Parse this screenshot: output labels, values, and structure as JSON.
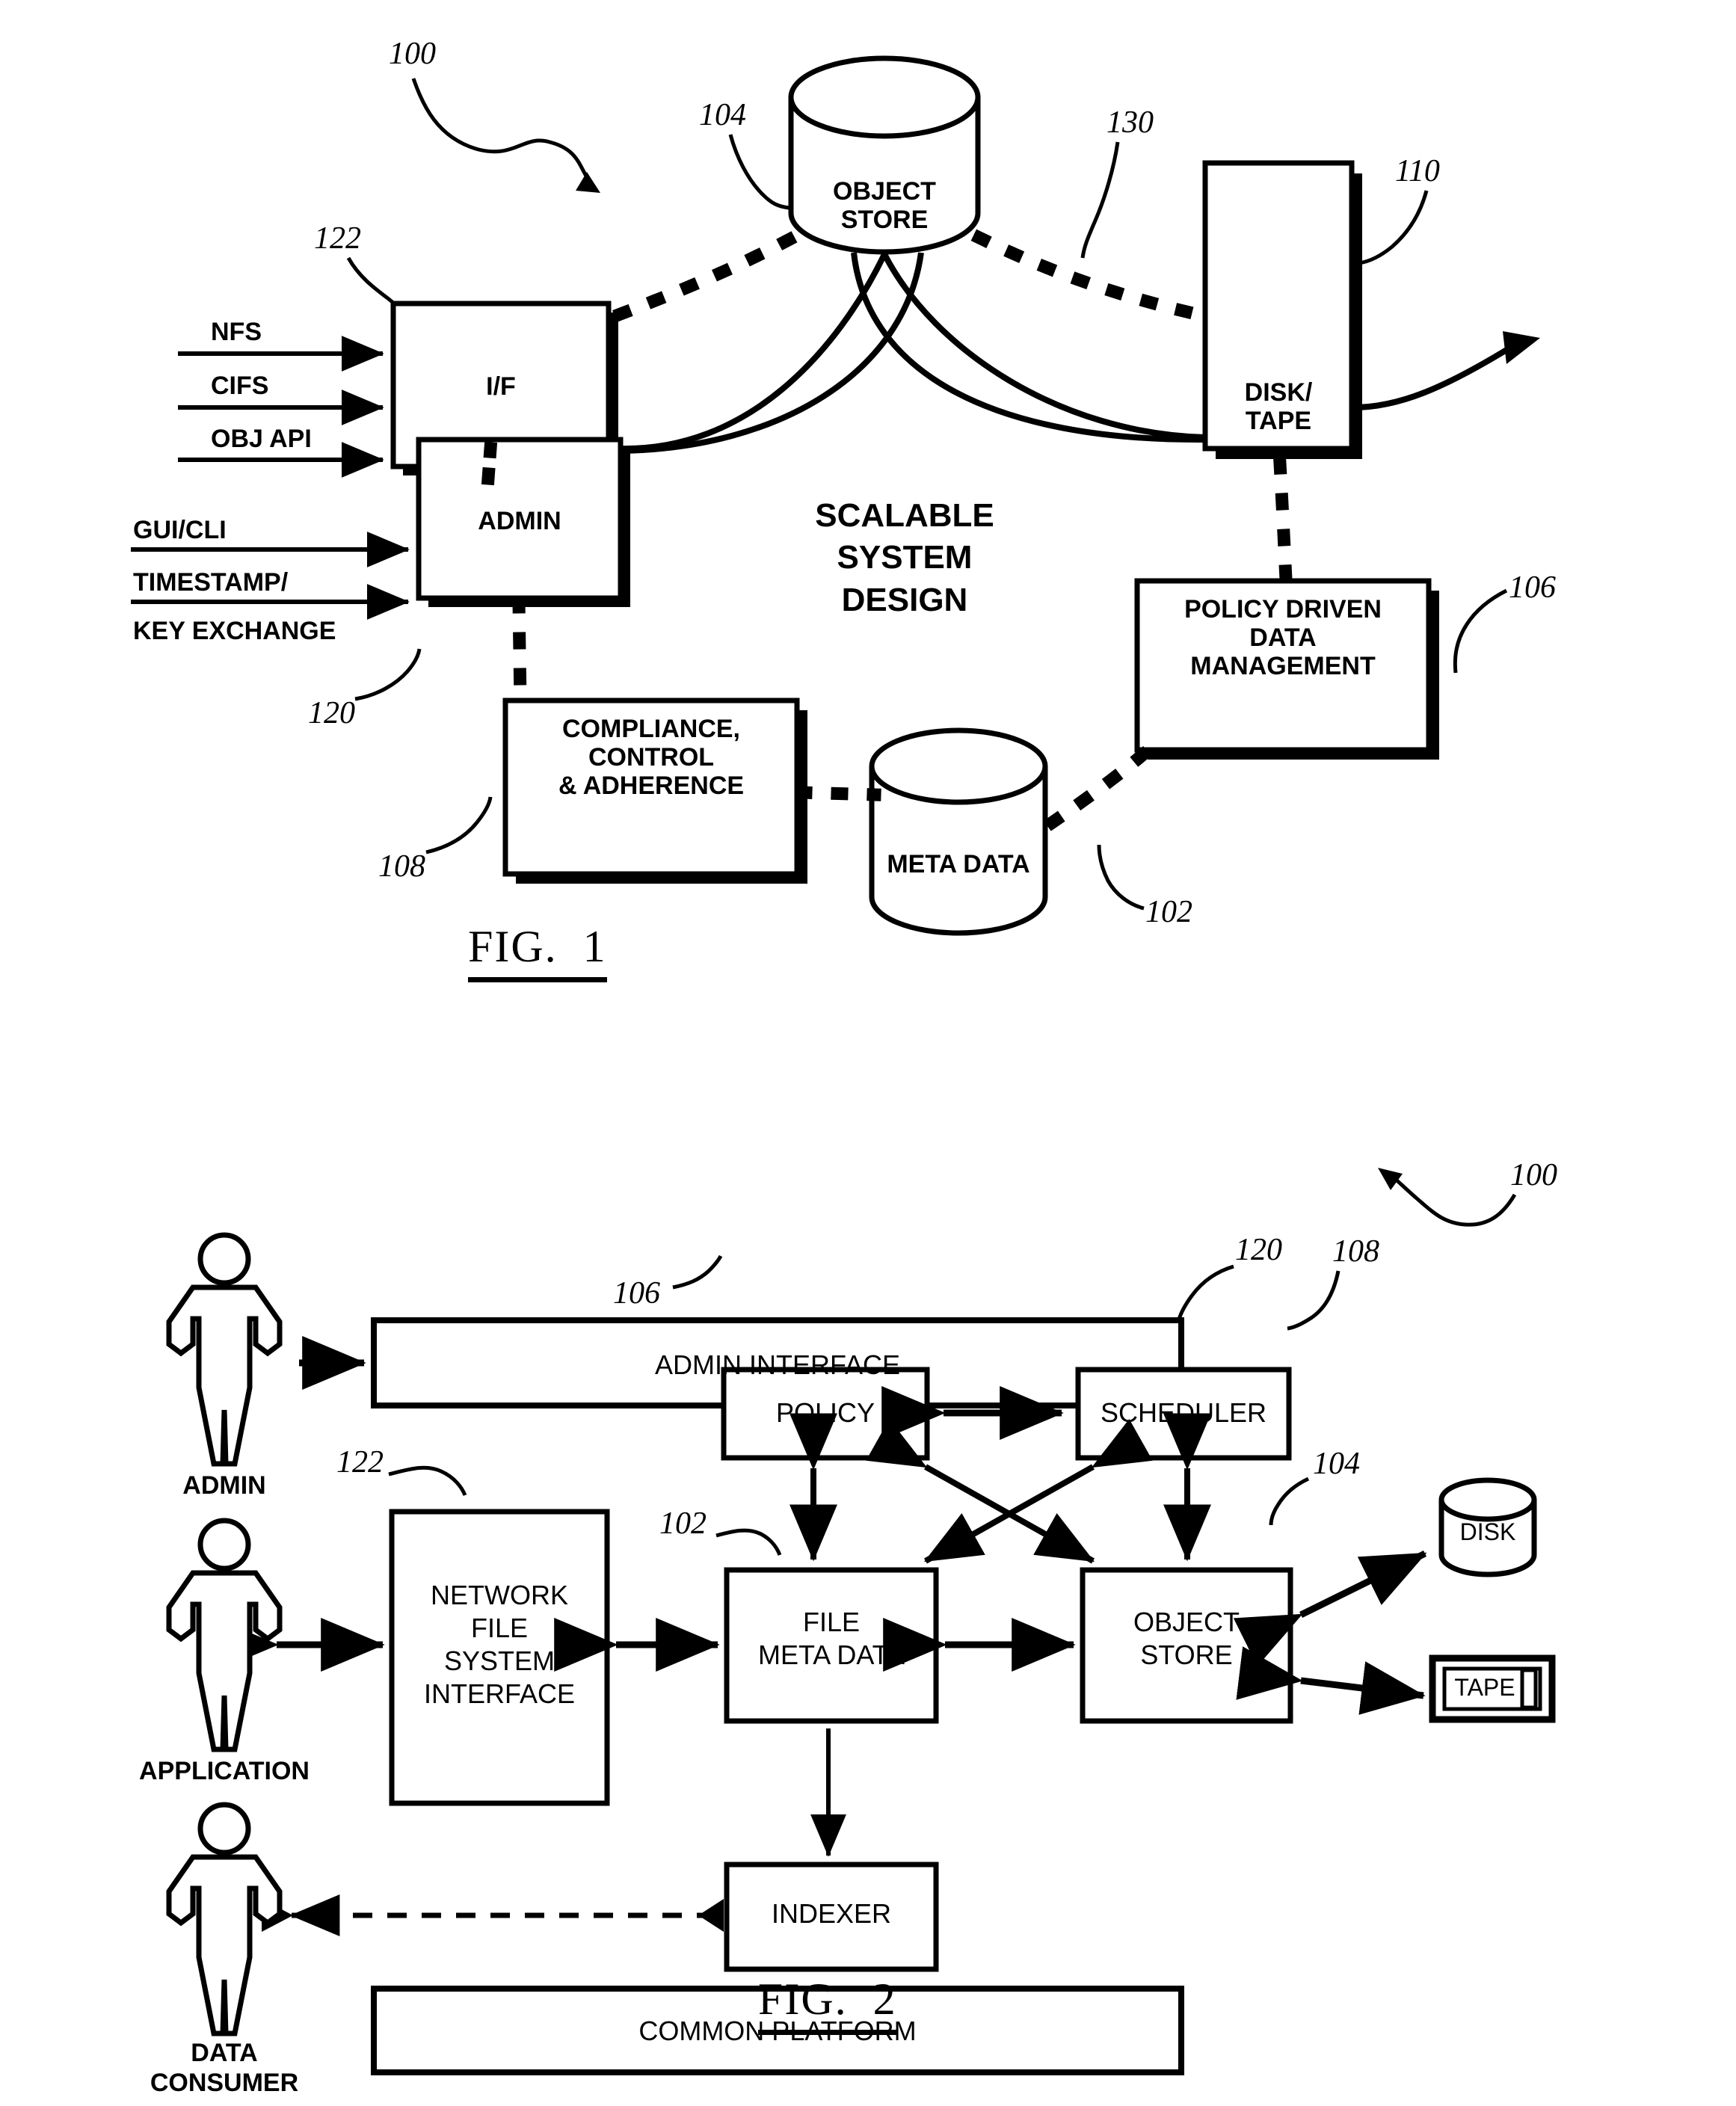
{
  "document": {
    "type": "patent-drawing-sheet",
    "figures": [
      {
        "caption": "FIG.  1",
        "title_block": "SCALABLE\nSYSTEM\nDESIGN",
        "title_lines": [
          "SCALABLE",
          "SYSTEM",
          "DESIGN"
        ],
        "inputs_interface": [
          "NFS",
          "CIFS",
          "OBJ API"
        ],
        "inputs_admin": [
          "GUI/CLI",
          "TIMESTAMP/",
          "KEY EXCHANGE"
        ],
        "nodes": [
          {
            "id": "if",
            "label": "I/F",
            "shape": "box-shadow"
          },
          {
            "id": "admin",
            "label": "ADMIN",
            "shape": "box-shadow"
          },
          {
            "id": "objstore",
            "label": "OBJECT\nSTORE",
            "shape": "cylinder"
          },
          {
            "id": "disktape",
            "label": "DISK/\nTAPE",
            "shape": "box-shadow"
          },
          {
            "id": "policy",
            "label": "POLICY DRIVEN\nDATA\nMANAGEMENT",
            "shape": "box-shadow"
          },
          {
            "id": "compl",
            "label": "COMPLIANCE,\nCONTROL\n& ADHERENCE",
            "shape": "box-shadow"
          },
          {
            "id": "metadata",
            "label": "META DATA",
            "shape": "cylinder"
          }
        ],
        "reference_numerals": [
          {
            "num": "100",
            "target": "system"
          },
          {
            "num": "122",
            "target": "if"
          },
          {
            "num": "104",
            "target": "objstore"
          },
          {
            "num": "130",
            "target": "link"
          },
          {
            "num": "110",
            "target": "disktape"
          },
          {
            "num": "106",
            "target": "policy"
          },
          {
            "num": "120",
            "target": "admin"
          },
          {
            "num": "108",
            "target": "compl"
          },
          {
            "num": "102",
            "target": "metadata"
          }
        ]
      },
      {
        "caption": "FIG.  2",
        "actors": [
          {
            "id": "admin",
            "label": "ADMIN"
          },
          {
            "id": "app",
            "label": "APPLICATION"
          },
          {
            "id": "consumer",
            "label": "DATA\nCONSUMER"
          }
        ],
        "nodes": [
          {
            "id": "admin_if",
            "label": "ADMIN INTERFACE",
            "shape": "bar"
          },
          {
            "id": "policy",
            "label": "POLICY",
            "shape": "box"
          },
          {
            "id": "sched",
            "label": "SCHEDULER",
            "shape": "box"
          },
          {
            "id": "nfsif",
            "label": "NETWORK\nFILE\nSYSTEM\nINTERFACE",
            "shape": "box"
          },
          {
            "id": "fmd",
            "label": "FILE\nMETA DATA",
            "shape": "box"
          },
          {
            "id": "objstore",
            "label": "OBJECT\nSTORE",
            "shape": "box"
          },
          {
            "id": "indexer",
            "label": "INDEXER",
            "shape": "box"
          },
          {
            "id": "platform",
            "label": "COMMON PLATFORM",
            "shape": "bar"
          },
          {
            "id": "disk",
            "label": "DISK",
            "shape": "cylinder"
          },
          {
            "id": "tape",
            "label": "TAPE",
            "shape": "cartridge"
          }
        ],
        "reference_numerals": [
          {
            "num": "100",
            "target": "system"
          },
          {
            "num": "120",
            "target": "admin_if"
          },
          {
            "num": "108",
            "target": "sched"
          },
          {
            "num": "106",
            "target": "policy"
          },
          {
            "num": "122",
            "target": "nfsif"
          },
          {
            "num": "102",
            "target": "fmd"
          },
          {
            "num": "104",
            "target": "objstore"
          }
        ]
      }
    ]
  },
  "colors": {
    "ink": "#000000",
    "paper": "#ffffff"
  }
}
